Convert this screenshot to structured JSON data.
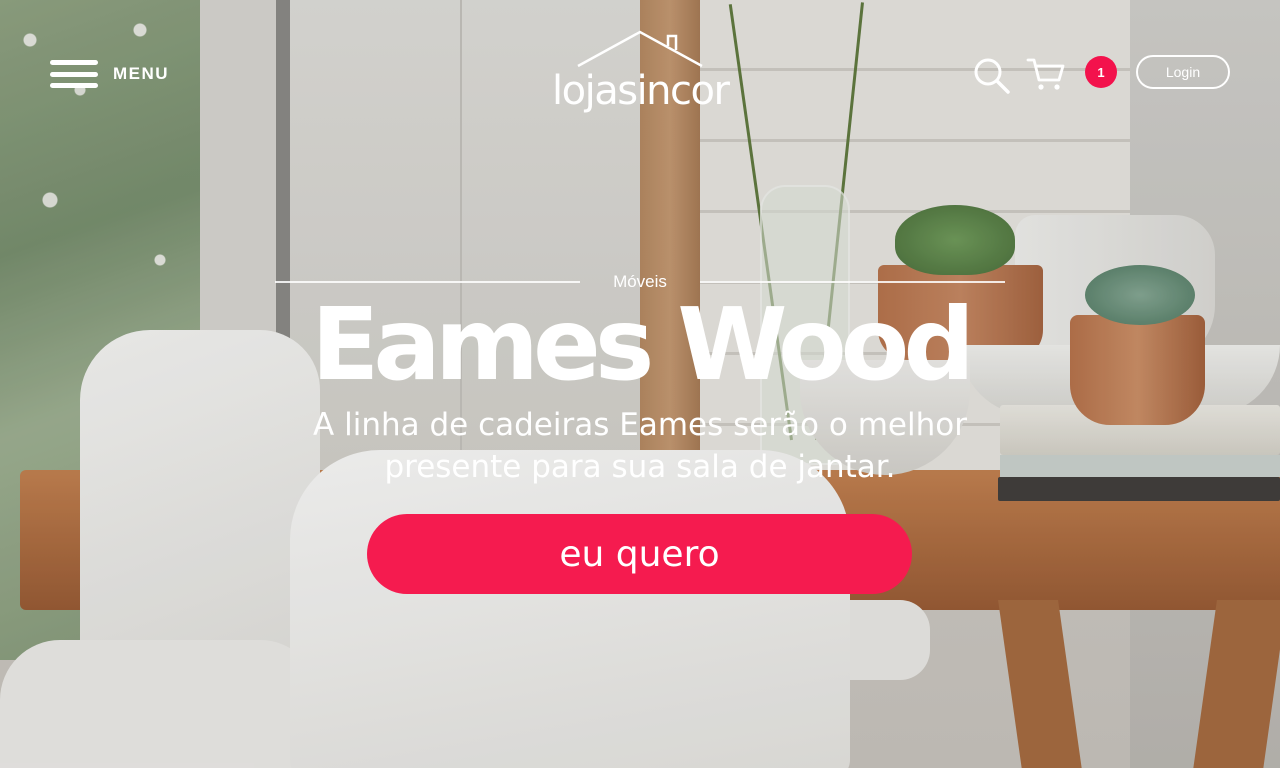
{
  "header": {
    "menu_label": "MENU",
    "logo_text": "lojasincor",
    "cart_count": "1",
    "login_label": "Login"
  },
  "hero": {
    "eyebrow": "Móveis",
    "title": "Eames Wood",
    "subtitle_line1": "A linha de cadeiras Eames serão o melhor",
    "subtitle_line2": "presente para sua sala de jantar.",
    "cta_label": "eu quero"
  },
  "icons": [
    "menu-icon",
    "house-roof-icon",
    "search-icon",
    "cart-icon"
  ],
  "colors": {
    "accent": "#f51b4f",
    "badge": "#f3124c",
    "text": "#ffffff"
  }
}
